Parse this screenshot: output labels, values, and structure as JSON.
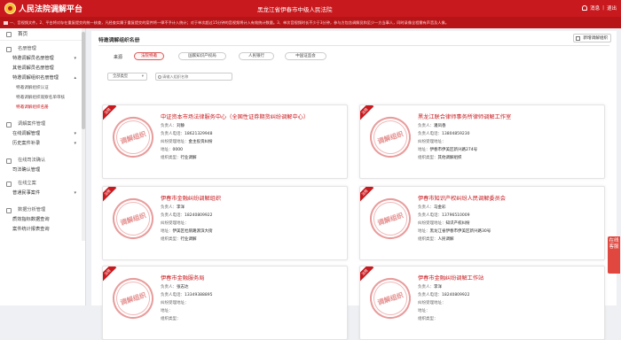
{
  "app": {
    "title": "人民法院调解平台",
    "court_name": "黑龙江省伊春市中级人民法院",
    "user_label": "消息",
    "logout_label": "退出"
  },
  "notice": "一、音视频文件。2、平台将对存在重复提交的统一核查，凡经查实属于重复提交的案件将一律不予计入统计；对于单次超过15分钟的音视频将计入有效统计数量。3、单次音视频时长不少于3分钟，参与方包含调解员和至少一方当事人，同时录像全程需有声音及人像。",
  "sidebar": {
    "home": "首页",
    "groups": [
      {
        "title": "名册管理",
        "items": [
          {
            "label": "特邀调解员名册管理",
            "chevron": "▾"
          },
          {
            "label": "其他调解员名册管理"
          },
          {
            "label": "特邀调解组织名册管理",
            "chevron": "▴",
            "children": [
              "特邀调解组织认证",
              "特邀调解组织观察名单审核",
              "特邀调解组织名册"
            ]
          }
        ]
      },
      {
        "title": "调解案件管理",
        "items": [
          {
            "label": "在线调解管理",
            "chevron": "▾"
          },
          {
            "label": "历史案件补录",
            "chevron": "▾"
          }
        ]
      },
      {
        "title": "在线司法确认",
        "items": [
          {
            "label": "司法确认管理"
          }
        ]
      },
      {
        "title": "在线立案",
        "items": [
          {
            "label": "普通民事案件",
            "chevron": "▾"
          }
        ]
      },
      {
        "title": "数据分析管理",
        "items": [
          {
            "label": "质效指标数据查询"
          },
          {
            "label": "案件统计报表查询"
          }
        ]
      }
    ]
  },
  "main": {
    "title": "特邀调解组织名册",
    "add_button": "新增调解组织",
    "source_label": "来源",
    "tabs": [
      "法院特邀",
      "国家知识产权局",
      "人民银行",
      "中国证监会"
    ],
    "active_tab": 0,
    "select_value": "全部类型",
    "search_placeholder": "请输入组织名称"
  },
  "card_labels": {
    "badge": "法院",
    "stamp": "调解组织",
    "leader": "负责人：",
    "phone": "负责人电话：",
    "address": "纠纷受理地址：",
    "scope": "地址：",
    "type": "组织类型："
  },
  "cards": [
    {
      "name": "中证资本市场法律服务中心（全国性证券期货纠纷调解中心）",
      "leader": "刘静",
      "phone": "18621329948",
      "address": "金主投资纠纷",
      "scope": "0000",
      "type": "行业调解"
    },
    {
      "name": "黑龙江联合律师事务所律师调解工作室",
      "leader": "潘凤香",
      "phone": "13804859230",
      "address": "",
      "scope": "伊春市伊美区新兴路274号",
      "type": "其他调解组织"
    },
    {
      "name": "伊春市金融纠纷调解组织",
      "leader": "李洋",
      "phone": "18240809922",
      "address": "",
      "scope": "伊美区杜鹃路渡滨大街",
      "type": "行业调解"
    },
    {
      "name": "伊春市知识产权纠纷人民调解委员会",
      "leader": "马金彩",
      "phone": "13796510009",
      "address": "知识产权纠纷",
      "scope": "黑龙江省伊春市伊美区新兴路30号",
      "type": "人民调解"
    },
    {
      "name": "伊春市金融服务局",
      "leader": "张志达",
      "phone": "13349388895",
      "address": "",
      "scope": "",
      "type": ""
    },
    {
      "name": "伊春市金融纠纷调解工作站",
      "leader": "李洋",
      "phone": "18240809922",
      "address": "",
      "scope": "",
      "type": ""
    }
  ],
  "float_tab": "在线客服"
}
